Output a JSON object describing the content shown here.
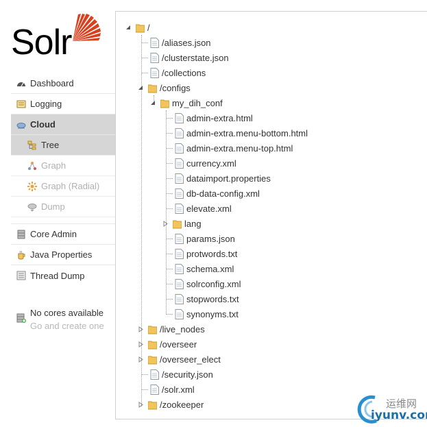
{
  "logo": {
    "text": "Solr"
  },
  "nav": {
    "dashboard": "Dashboard",
    "logging": "Logging",
    "cloud": "Cloud",
    "cloud_sub": {
      "tree": "Tree",
      "graph": "Graph",
      "graph_radial": "Graph (Radial)",
      "dump": "Dump"
    },
    "core_admin": "Core Admin",
    "java_properties": "Java Properties",
    "thread_dump": "Thread Dump"
  },
  "cores": {
    "line1": "No cores available",
    "line2": "Go and create one"
  },
  "tree": {
    "root": "/",
    "aliases": "/aliases.json",
    "clusterstate": "/clusterstate.json",
    "collections": "/collections",
    "configs": "/configs",
    "my_dih_conf": "my_dih_conf",
    "files": {
      "f0": "admin-extra.html",
      "f1": "admin-extra.menu-bottom.html",
      "f2": "admin-extra.menu-top.html",
      "f3": "currency.xml",
      "f4": "dataimport.properties",
      "f5": "db-data-config.xml",
      "f6": "elevate.xml",
      "f7": "lang",
      "f8": "params.json",
      "f9": "protwords.txt",
      "f10": "schema.xml",
      "f11": "solrconfig.xml",
      "f12": "stopwords.txt",
      "f13": "synonyms.txt"
    },
    "live_nodes": "/live_nodes",
    "overseer": "/overseer",
    "overseer_elect": "/overseer_elect",
    "security": "/security.json",
    "solr_xml": "/solr.xml",
    "zookeeper": "/zookeeper"
  },
  "watermark": {
    "cn": "运维网",
    "en": "iyunv.com"
  },
  "colors": {
    "logo_red": "#d9411e",
    "folder": "#f2c55c",
    "active_bg": "#d6d6d6"
  }
}
